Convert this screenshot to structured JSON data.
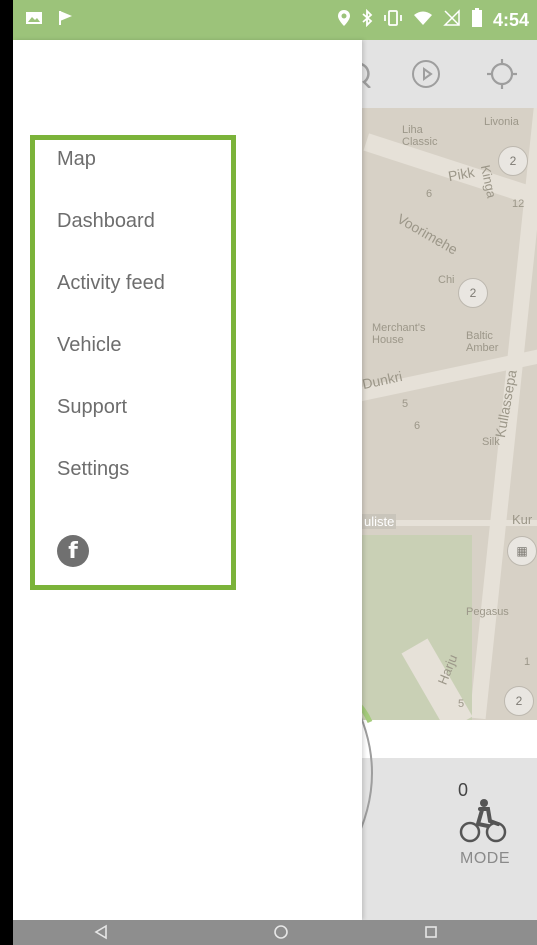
{
  "status_bar": {
    "time": "4:54",
    "left_icons": [
      "image-icon",
      "flag-icon"
    ],
    "right_icons": [
      "location-icon",
      "bluetooth-icon",
      "vibrate-icon",
      "wifi-icon",
      "no-sim-icon",
      "battery-icon"
    ],
    "color": "#9CC37A"
  },
  "drawer": {
    "menu_items": [
      {
        "label": "Map"
      },
      {
        "label": "Dashboard"
      },
      {
        "label": "Activity feed"
      },
      {
        "label": "Vehicle"
      },
      {
        "label": "Support"
      },
      {
        "label": "Settings"
      }
    ],
    "social_icon": "facebook-icon",
    "highlight_color": "#7BB33A"
  },
  "map": {
    "toolbar_icons": [
      "search-icon",
      "play-icon",
      "target-icon"
    ],
    "labels": {
      "livonia": "Livonia",
      "lihaclassic": "Liha Classic",
      "pikk": "Pikk",
      "kinga": "Kinga",
      "voorimehe": "Voorimehe",
      "chi": "Chi",
      "merchants": "Merchant's House",
      "baltic": "Baltic Amber",
      "dunkri": "Dunkri",
      "silk": "Silk",
      "kullassepa": "Kullassepa",
      "kur": "Kur",
      "uliste": "uliste",
      "pegasus": "Pegasus",
      "harju": "Harju",
      "num6": "6",
      "num12": "12",
      "num5a": "5",
      "num5b": "5",
      "num6b": "6",
      "num1": "1"
    }
  },
  "mode_panel": {
    "count": "0",
    "label": "MODE",
    "icon": "bicycle-icon"
  },
  "nav_bar": {
    "buttons": [
      "back-icon",
      "home-icon",
      "recents-icon"
    ]
  }
}
